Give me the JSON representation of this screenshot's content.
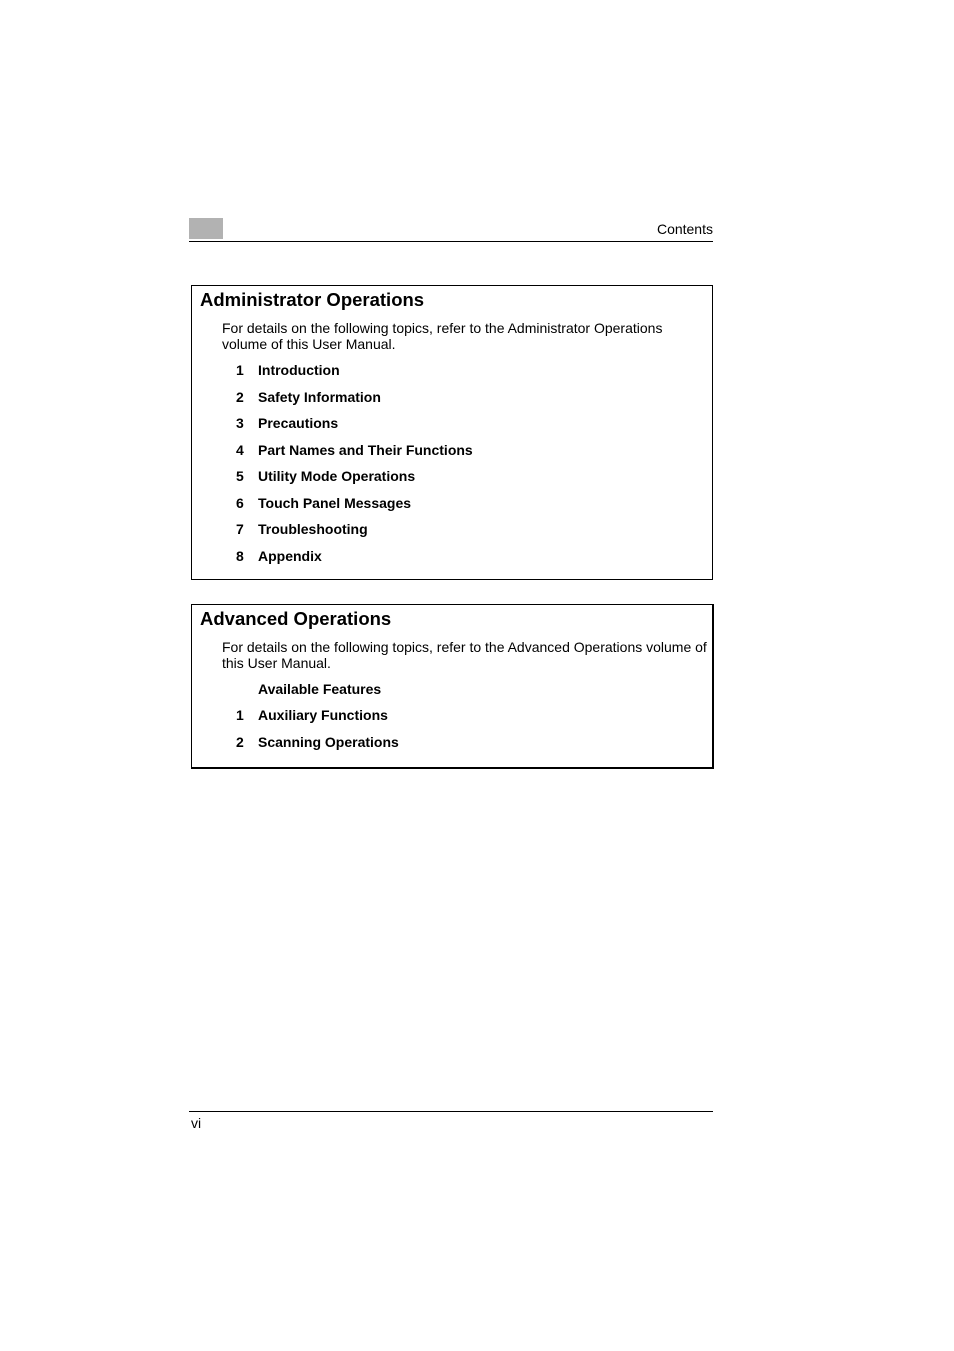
{
  "header": {
    "title": "Contents"
  },
  "sections": [
    {
      "title": "Administrator Operations",
      "description": "For details on the following topics, refer to the Administrator Operations volume of this User Manual.",
      "items": [
        {
          "num": "1",
          "label": "Introduction"
        },
        {
          "num": "2",
          "label": "Safety Information"
        },
        {
          "num": "3",
          "label": "Precautions"
        },
        {
          "num": "4",
          "label": "Part Names and Their Functions"
        },
        {
          "num": "5",
          "label": "Utility Mode Operations"
        },
        {
          "num": "6",
          "label": "Touch Panel Messages"
        },
        {
          "num": "7",
          "label": "Troubleshooting"
        },
        {
          "num": "8",
          "label": "Appendix"
        }
      ]
    },
    {
      "title": "Advanced Operations",
      "description": "For details on the following topics, refer to the Advanced Operations volume of this User Manual.",
      "items": [
        {
          "num": "",
          "label": "Available Features"
        },
        {
          "num": "1",
          "label": "Auxiliary Functions"
        },
        {
          "num": "2",
          "label": "Scanning Operations"
        }
      ]
    }
  ],
  "footer": {
    "page_number": "vi"
  }
}
